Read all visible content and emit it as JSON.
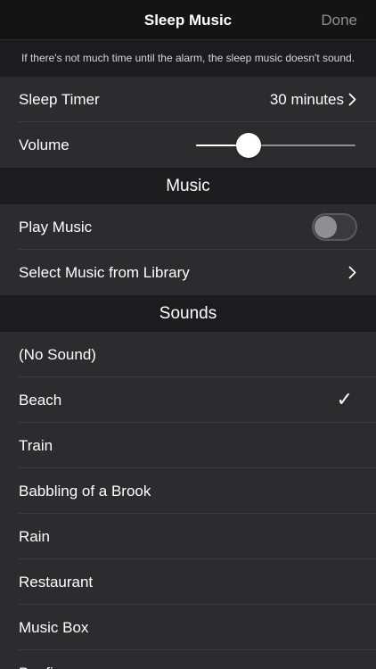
{
  "navbar": {
    "title": "Sleep Music",
    "done_label": "Done"
  },
  "notice": "If there's not much time until the alarm, the sleep music doesn't sound.",
  "settings": {
    "sleep_timer_label": "Sleep Timer",
    "sleep_timer_value": "30 minutes",
    "volume_label": "Volume",
    "volume_level": 0.33
  },
  "music_section": {
    "header": "Music",
    "play_music_label": "Play Music",
    "play_music_on": false,
    "select_library_label": "Select Music from Library"
  },
  "sounds_section": {
    "header": "Sounds",
    "items": [
      {
        "label": "(No Sound)",
        "selected": false
      },
      {
        "label": "Beach",
        "selected": true
      },
      {
        "label": "Train",
        "selected": false
      },
      {
        "label": "Babbling of a Brook",
        "selected": false
      },
      {
        "label": "Rain",
        "selected": false
      },
      {
        "label": "Restaurant",
        "selected": false
      },
      {
        "label": "Music Box",
        "selected": false
      },
      {
        "label": "Bonfire",
        "selected": false
      }
    ],
    "check_glyph": "✓"
  },
  "colors": {
    "background": "#1c1c1e",
    "cell": "#2c2c2e",
    "navbar": "#141414",
    "done": "#8e8e93"
  }
}
